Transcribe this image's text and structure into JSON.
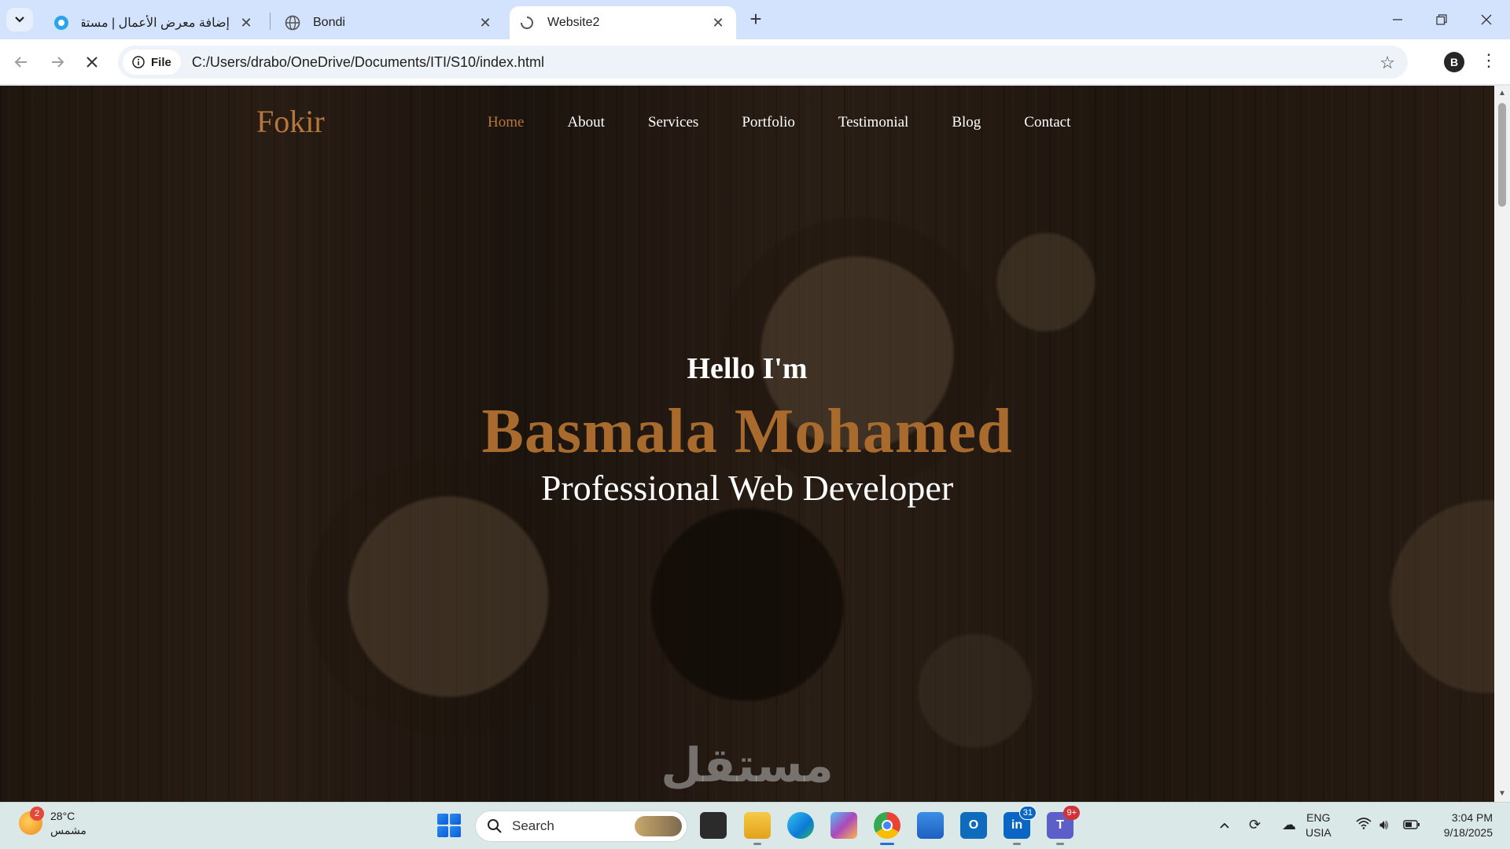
{
  "browser": {
    "tabs": [
      {
        "label": "إضافة معرض الأعمال | مستقل",
        "icon": "mostaql-icon"
      },
      {
        "label": "Bondi",
        "icon": "globe-icon"
      },
      {
        "label": "Website2",
        "icon": "loading-icon",
        "active": true
      }
    ],
    "new_tab": "+",
    "site_info_chip": "File",
    "url": "C:/Users/drabo/OneDrive/Documents/ITI/S10/index.html",
    "profile_initial": "B"
  },
  "website": {
    "brand": "Fokir",
    "nav": [
      {
        "label": "Home",
        "active": true
      },
      {
        "label": "About"
      },
      {
        "label": "Services"
      },
      {
        "label": "Portfolio"
      },
      {
        "label": "Testimonial"
      },
      {
        "label": "Blog"
      },
      {
        "label": "Contact"
      }
    ],
    "hero": {
      "greeting": "Hello I'm",
      "name": "Basmala Mohamed",
      "role": "Professional Web Developer"
    },
    "accent_color": "#a86a2d",
    "watermark": "مستقل"
  },
  "taskbar": {
    "weather": {
      "temp": "28°C",
      "condition": "مشمس",
      "badge": "2"
    },
    "search_placeholder": "Search",
    "apps": [
      {
        "name": "task-view",
        "badge": ""
      },
      {
        "name": "file-explorer",
        "badge": ""
      },
      {
        "name": "edge",
        "badge": ""
      },
      {
        "name": "copilot",
        "badge": ""
      },
      {
        "name": "chrome",
        "badge": ""
      },
      {
        "name": "store",
        "badge": ""
      },
      {
        "name": "outlook",
        "badge": ""
      },
      {
        "name": "linkedin",
        "badge": "31"
      },
      {
        "name": "teams",
        "badge": "9+"
      }
    ],
    "lang_line1": "ENG",
    "lang_line2": "USIA",
    "time": "3:04 PM",
    "date": "9/18/2025"
  }
}
